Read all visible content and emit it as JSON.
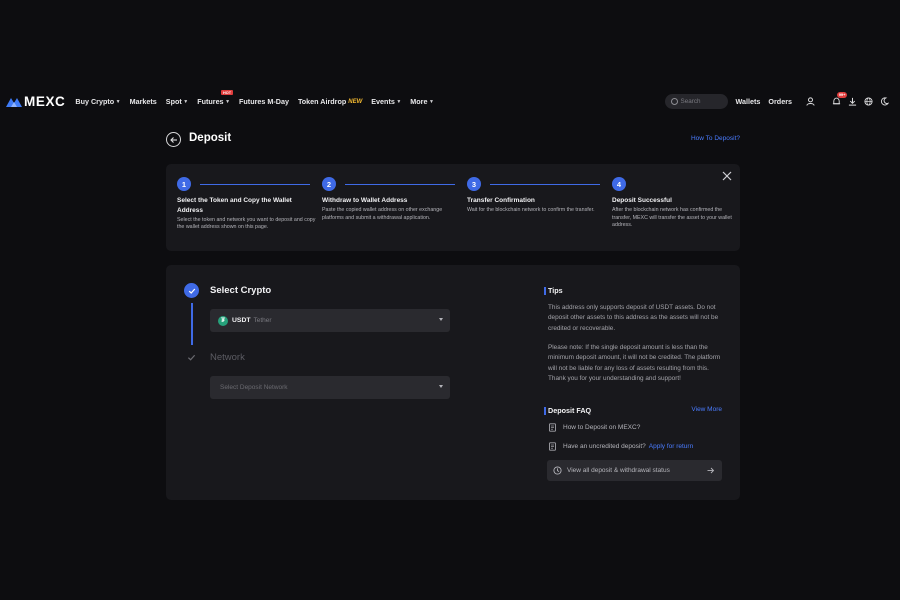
{
  "nav": {
    "logo_text": "MEXC",
    "items": [
      {
        "label": "Buy Crypto",
        "caret": true
      },
      {
        "label": "Markets",
        "caret": false
      },
      {
        "label": "Spot",
        "caret": true
      },
      {
        "label": "Futures",
        "caret": true,
        "badge": "HOT"
      },
      {
        "label": "Futures M-Day",
        "caret": false
      },
      {
        "label": "Token Airdrop",
        "caret": false,
        "tag": "NEW"
      },
      {
        "label": "Events",
        "caret": true
      },
      {
        "label": "More",
        "caret": true
      }
    ],
    "search_placeholder": "Search",
    "wallets": "Wallets",
    "orders": "Orders",
    "notification_badge": "99+"
  },
  "header": {
    "title": "Deposit",
    "how_link": "How To Deposit?"
  },
  "steps": [
    {
      "num": "1",
      "title": "Select the Token and Copy the Wallet Address",
      "desc": "Select the token and network you want to deposit and copy the wallet address shown on this page."
    },
    {
      "num": "2",
      "title": "Withdraw to Wallet Address",
      "desc": "Paste the copied wallet address on other exchange platforms and submit a withdrawal application."
    },
    {
      "num": "3",
      "title": "Transfer Confirmation",
      "desc": "Wait for the blockchain network to confirm the transfer."
    },
    {
      "num": "4",
      "title": "Deposit Successful",
      "desc": "After the blockchain network has confirmed the transfer, MEXC will transfer the asset to your wallet address."
    }
  ],
  "form": {
    "select_crypto_label": "Select Crypto",
    "crypto_symbol": "USDT",
    "crypto_name": "Tether",
    "network_label": "Network",
    "network_placeholder": "Select Deposit Network"
  },
  "tips": {
    "title": "Tips",
    "p1": "This address only supports deposit of USDT assets. Do not deposit other assets to this address as the assets will not be credited or recoverable.",
    "p2": "Please note: If the single deposit amount is less than the minimum deposit amount, it will not be credited. The platform will not be liable for any loss of assets resulting from this. Thank you for your understanding and support!"
  },
  "faq": {
    "title": "Deposit FAQ",
    "view_more": "View More",
    "q1": "How to Deposit on MEXC?",
    "q2": "Have an uncredited deposit?",
    "q2_link": "Apply for return",
    "status": "View all deposit & withdrawal status"
  },
  "colors": {
    "accent": "#3f6ae6",
    "link": "#4a7cff",
    "card": "#18181c",
    "background": "#0d0d10"
  }
}
